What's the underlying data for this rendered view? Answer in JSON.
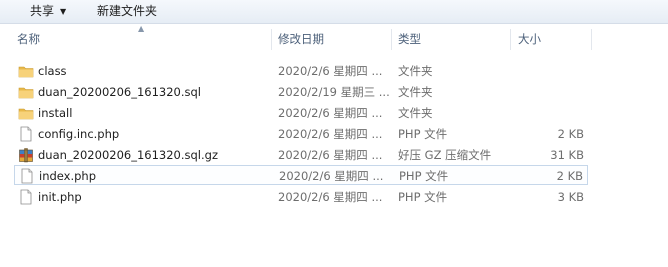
{
  "toolbar": {
    "share_label": "共享",
    "new_folder_label": "新建文件夹"
  },
  "columns": {
    "name": "名称",
    "date": "修改日期",
    "type": "类型",
    "size": "大小"
  },
  "files": [
    {
      "name": "class",
      "date": "2020/2/6 星期四 ...",
      "type": "文件夹",
      "size": "",
      "icon": "folder-icon"
    },
    {
      "name": "duan_20200206_161320.sql",
      "date": "2020/2/19 星期三 ...",
      "type": "文件夹",
      "size": "",
      "icon": "folder-icon"
    },
    {
      "name": "install",
      "date": "2020/2/6 星期四 ...",
      "type": "文件夹",
      "size": "",
      "icon": "folder-icon"
    },
    {
      "name": "config.inc.php",
      "date": "2020/2/6 星期四 ...",
      "type": "PHP 文件",
      "size": "2 KB",
      "icon": "php-file-icon"
    },
    {
      "name": "duan_20200206_161320.sql.gz",
      "date": "2020/2/6 星期四 ...",
      "type": "好压 GZ 压缩文件",
      "size": "31 KB",
      "icon": "archive-icon"
    },
    {
      "name": "index.php",
      "date": "2020/2/6 星期四 ...",
      "type": "PHP 文件",
      "size": "2 KB",
      "icon": "php-file-icon"
    },
    {
      "name": "init.php",
      "date": "2020/2/6 星期四 ...",
      "type": "PHP 文件",
      "size": "3 KB",
      "icon": "php-file-icon"
    }
  ]
}
